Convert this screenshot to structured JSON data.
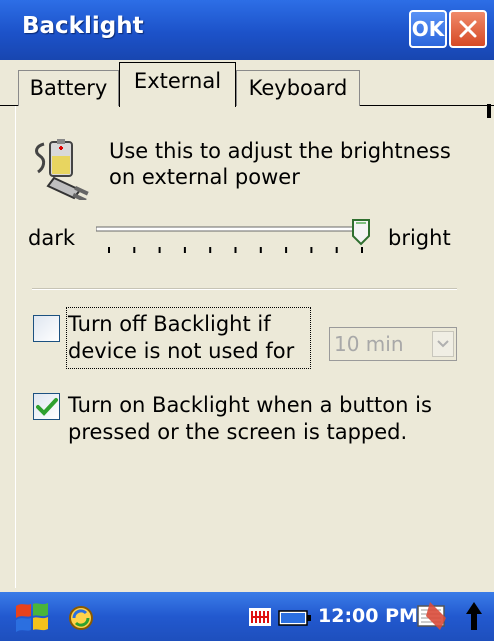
{
  "title": "Backlight",
  "title_buttons": {
    "ok": "OK"
  },
  "tabs": [
    {
      "label": "Battery",
      "active": false
    },
    {
      "label": "External",
      "active": true
    },
    {
      "label": "Keyboard",
      "active": false
    }
  ],
  "description": "Use this to adjust the brightness on external power",
  "slider": {
    "label_min": "dark",
    "label_max": "bright",
    "level": 1.0
  },
  "turn_off": {
    "checked": false,
    "label": "Turn off Backlight if device is not used for",
    "dropdown_value": "10 min"
  },
  "turn_on": {
    "checked": true,
    "label": "Turn on Backlight when a button is pressed or the screen is tapped."
  },
  "taskbar": {
    "clock": "12:00 PM"
  },
  "icons": [
    "power-plug-battery-icon",
    "windows-start-icon",
    "sync-icon",
    "signal-icon",
    "battery-icon",
    "keyboard-icon",
    "arrow-up-icon",
    "close-icon",
    "checkmark-icon",
    "chevron-down-icon"
  ],
  "colors": {
    "title_bar": "#1c52c9",
    "panel": "#ece9d8",
    "close": "#d64a26",
    "check": "#2fa12f"
  }
}
